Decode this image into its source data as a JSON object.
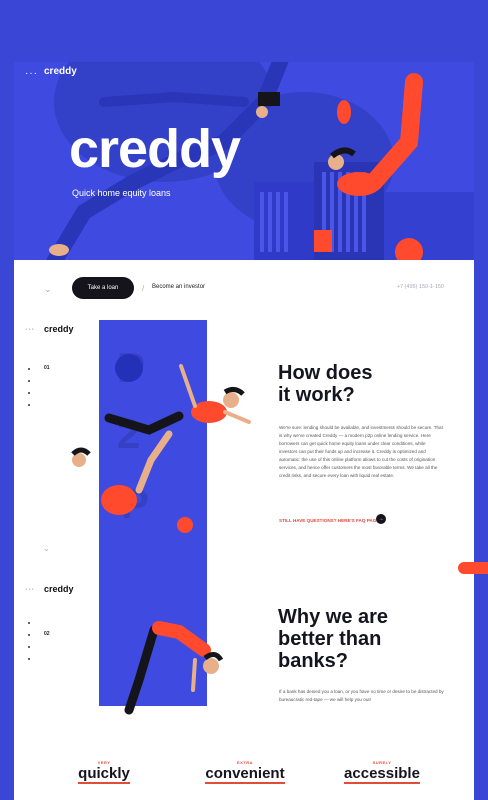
{
  "hero": {
    "menu_dots": "···",
    "logo_small": "creddy",
    "logo_big": "creddy",
    "tagline": "Quick home equity loans"
  },
  "navbar": {
    "take_loan": "Take a loan",
    "become_investor": "Become an investor",
    "phone": "+7 (495) 150-1-150"
  },
  "section1": {
    "logo": "creddy",
    "step": "01",
    "letters": [
      "P",
      "2",
      "P"
    ],
    "heading": [
      "How does",
      "it work?"
    ],
    "paragraph": "We're sure: lending should be available, and investments should be secure. That is why we've created Creddy — a modern p2p online lending service. Here borrowers can get quick home equity loans under clear conditions, while investors can put their funds up and increase it. Creddy is optimized and automatic: the use of this online platform allows to cut the costs of origination services, and hence offer customers the most favorable terms. We take all the credit risks, and secure every loan with liquid real estate.",
    "faq_link": "STILL HAVE QUESTIONS? HERE'S FAQ PAGE"
  },
  "section2": {
    "logo": "creddy",
    "step": "02",
    "heading": [
      "Why we are",
      "better than",
      "banks?"
    ],
    "paragraph": "If a bank has denied you a loan, or you have no time or desire to be distracted by bureaucratic red-tape — we will help you out!"
  },
  "benefits": [
    {
      "small": "VERY",
      "big": "quickly"
    },
    {
      "small": "EXTRA",
      "big": "convenient"
    },
    {
      "small": "SURELY",
      "big": "accessible"
    }
  ],
  "colors": {
    "brand_blue": "#3f4be0",
    "accent_red": "#ff4a2e",
    "dark": "#14141a"
  }
}
